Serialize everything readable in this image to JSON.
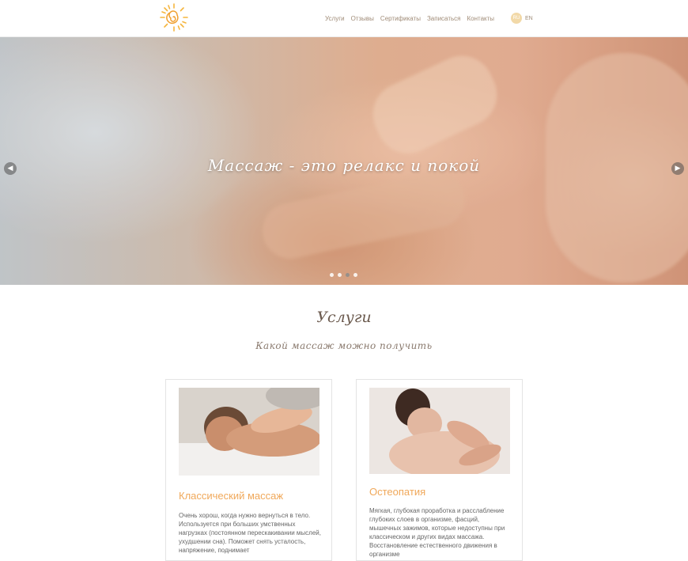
{
  "header": {
    "logo_icon": "sun-icon",
    "nav": [
      {
        "label": "Услуги"
      },
      {
        "label": "Отзывы"
      },
      {
        "label": "Сертификаты"
      },
      {
        "label": "Записаться"
      },
      {
        "label": "Контакты"
      }
    ],
    "lang": {
      "ru": "RU",
      "en": "EN"
    }
  },
  "hero": {
    "title": "Массаж - это релакс и покой",
    "arrow_prev": "◀",
    "arrow_next": "▶",
    "slides": 4,
    "active_slide": 3
  },
  "services": {
    "title": "Услуги",
    "subtitle": "Какой массаж можно получить",
    "cards": [
      {
        "title": "Классический массаж",
        "text": "Очень хорош, когда нужно вернуться в тело. Используется при больших умственных нагрузках (постоянном перескакивании мыслей, ухудшении сна). Поможет снять усталость, напряжение, поднимает"
      },
      {
        "title": "Остеопатия",
        "text": "Мягкая, глубокая проработка и расслабление глубоких слоев в организме, фасций, мышечных зажимов, которые недоступны при классическом и других видах массажа. Восстановление естественного движения в организме"
      }
    ]
  },
  "colors": {
    "accent": "#f0a85a",
    "nav_text": "#a08c78"
  }
}
